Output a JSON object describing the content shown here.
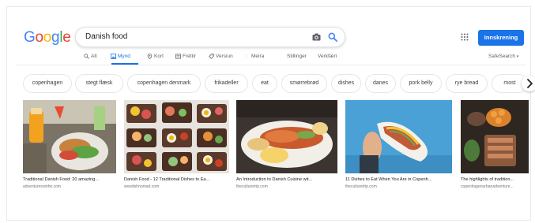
{
  "search": {
    "query": "Danish food"
  },
  "logo": {
    "letters": [
      "G",
      "o",
      "o",
      "g",
      "l",
      "e"
    ],
    "colors": [
      "#4285f4",
      "#ea4335",
      "#fbbc05",
      "#4285f4",
      "#34a853",
      "#ea4335"
    ]
  },
  "header": {
    "signin_label": "Innskrening"
  },
  "tabs": [
    {
      "label": "Alt",
      "icon": "search-icon"
    },
    {
      "label": "Mynd",
      "icon": "image-icon",
      "active": true
    },
    {
      "label": "Kort",
      "icon": "map-pin-icon"
    },
    {
      "label": "Fréttir",
      "icon": "news-icon"
    },
    {
      "label": "Versiun",
      "icon": "tag-icon"
    },
    {
      "label": "Meira"
    },
    {
      "label": "Stillinger"
    },
    {
      "label": "Verkfæri"
    }
  ],
  "safesearch_label": "SafeSearch",
  "chips": [
    "copenhagen",
    "stegt flæsk",
    "copenhagen denmark",
    "frikadeller",
    "eat",
    "smørrebrød",
    "dishes",
    "danes",
    "pork belly",
    "rye bread",
    "most"
  ],
  "results": [
    {
      "title": "Traditional Danish Food: 20 amazing...",
      "source": "adventuresonthe.com"
    },
    {
      "title": "Danish Food - 12 Traditional Dishes to Ea...",
      "source": "swedishnomad.com"
    },
    {
      "title": "An Introduction to Danish Cuisine wit...",
      "source": "theculturetrip.com"
    },
    {
      "title": "11 Dishes to Eat When You Are in Copenh...",
      "source": "theculturetrip.com"
    },
    {
      "title": "The highlights of tradition...",
      "source": "copenhagenurbanadventure..."
    }
  ],
  "accent_color": "#1a73e8"
}
